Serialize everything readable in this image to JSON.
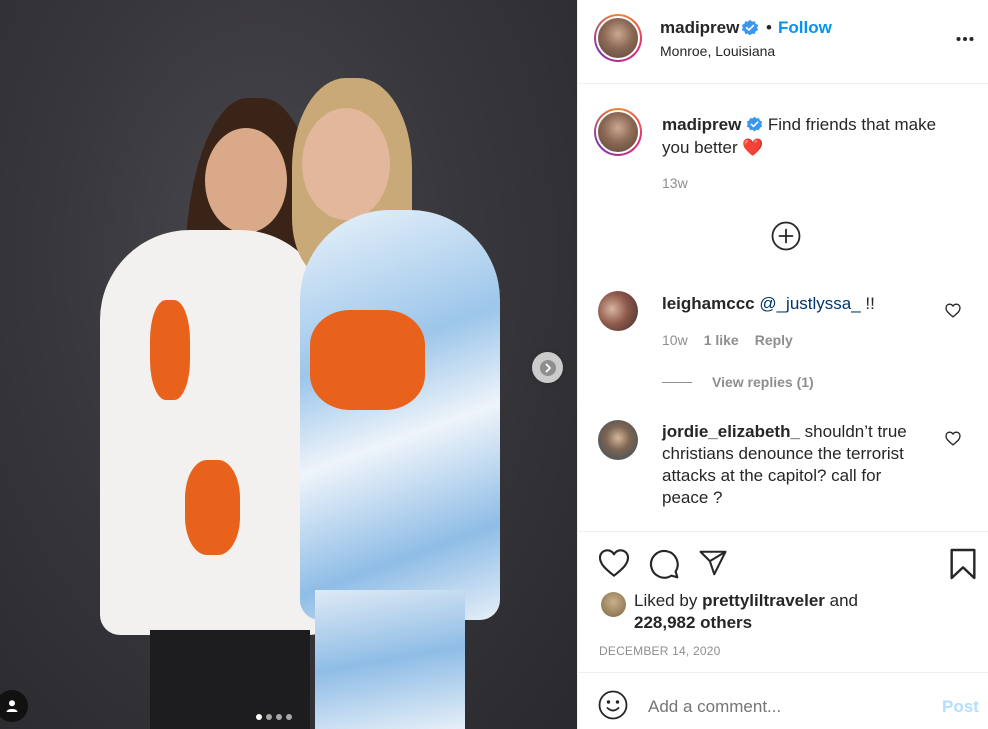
{
  "post": {
    "username": "madiprew",
    "follow_label": "Follow",
    "separator": "•",
    "location": "Monroe, Louisiana",
    "caption_text": "Find friends that make you better",
    "caption_emoji": "❤️",
    "caption_time": "13w",
    "carousel": {
      "total_dots": 4,
      "active_index": 0
    }
  },
  "comments": [
    {
      "username": "leighamccc",
      "mention": "@_justlyssa_",
      "text": " !!",
      "time": "10w",
      "likes": "1 like",
      "reply_label": "Reply",
      "view_replies": "View replies (1)"
    },
    {
      "username": "jordie_elizabeth_",
      "text": "shouldn’t true christians denounce the terrorist attacks at the capitol? call for peace ?"
    }
  ],
  "likes": {
    "prefix": "Liked by",
    "user": "prettyliltraveler",
    "suffix": "and",
    "count": "228,982 others"
  },
  "date": "DECEMBER 14, 2020",
  "add_comment": {
    "placeholder": "Add a comment...",
    "post_label": "Post"
  },
  "icons": [
    "more-icon",
    "verified-icon",
    "plus-circle-icon",
    "heart-icon",
    "comment-icon",
    "share-icon",
    "bookmark-icon",
    "emoji-icon",
    "chevron-right-icon",
    "user-tag-icon"
  ],
  "colors": {
    "accent": "#0095f6",
    "muted": "#8e8e8e",
    "post_disabled": "#b2dffc",
    "heart_emoji": "#e0245e"
  }
}
